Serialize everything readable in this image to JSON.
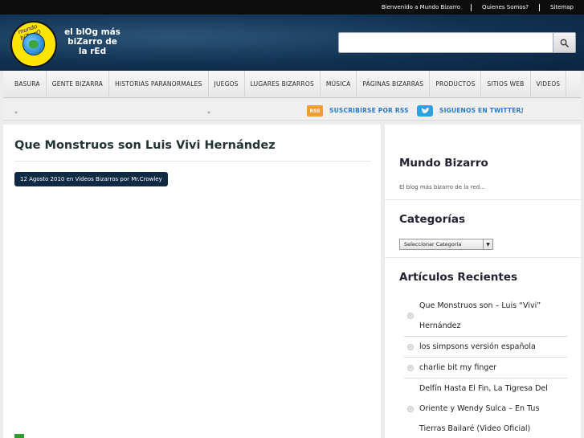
{
  "topbar": {
    "links": [
      "Bienvenido a Mundo Bizarro",
      "Quienes Somos?",
      "Sitemap"
    ]
  },
  "header": {
    "logo_text": "mundo biZarrO",
    "tagline": "el blOg más biZarro de la rEd",
    "search_placeholder": ""
  },
  "nav": {
    "items": [
      "BASURA",
      "GENTE BIZARRA",
      "HISTORIAS PARANORMALES",
      "JUEGOS",
      "LUGARES BIZARROS",
      "MÚSICA",
      "PÁGINAS BIZARRAS",
      "PRODUCTOS",
      "SITIOS WEB",
      "VIDEOS"
    ]
  },
  "subnav": {
    "rss_icon": "RSS",
    "rss_label": "SUSCRIBIRSE POR RSS",
    "twitter_label": "SIGUENOS EN TWITTER!",
    "dots": [
      "»",
      "»",
      "»"
    ]
  },
  "post": {
    "title": "Que Monstruos son Luis Vivi Hernández",
    "meta": "12 Agosto 2010 en Videos Bizarros por Mr.Crowley"
  },
  "sidebar": {
    "mundo_title": "Mundo Bizarro",
    "mundo_desc": "El blog más bizarro de la red...",
    "categories_title": "Categorías",
    "categories_select": "Seleccionar Categoría",
    "recent_title": "Artículos Recientes",
    "recent_items": [
      "Que Monstruos son – Luis “Vivi” Hernández",
      "los simpsons versión española",
      "charlie bit my finger",
      "Delfín Hasta El Fin, La Tigresa Del Oriente y Wendy Sulca – En Tus Tierras Bailaré (Video Oficial)"
    ]
  },
  "colors": {
    "header_bg": "#123252",
    "topbar_bg": "#0d0d0d",
    "meta_bg": "#0f2a45",
    "link_blue": "#2a7bc8",
    "rss_orange": "#f19d36",
    "twitter_blue": "#2aa3e0",
    "logo_yellow": "#ffe400"
  }
}
